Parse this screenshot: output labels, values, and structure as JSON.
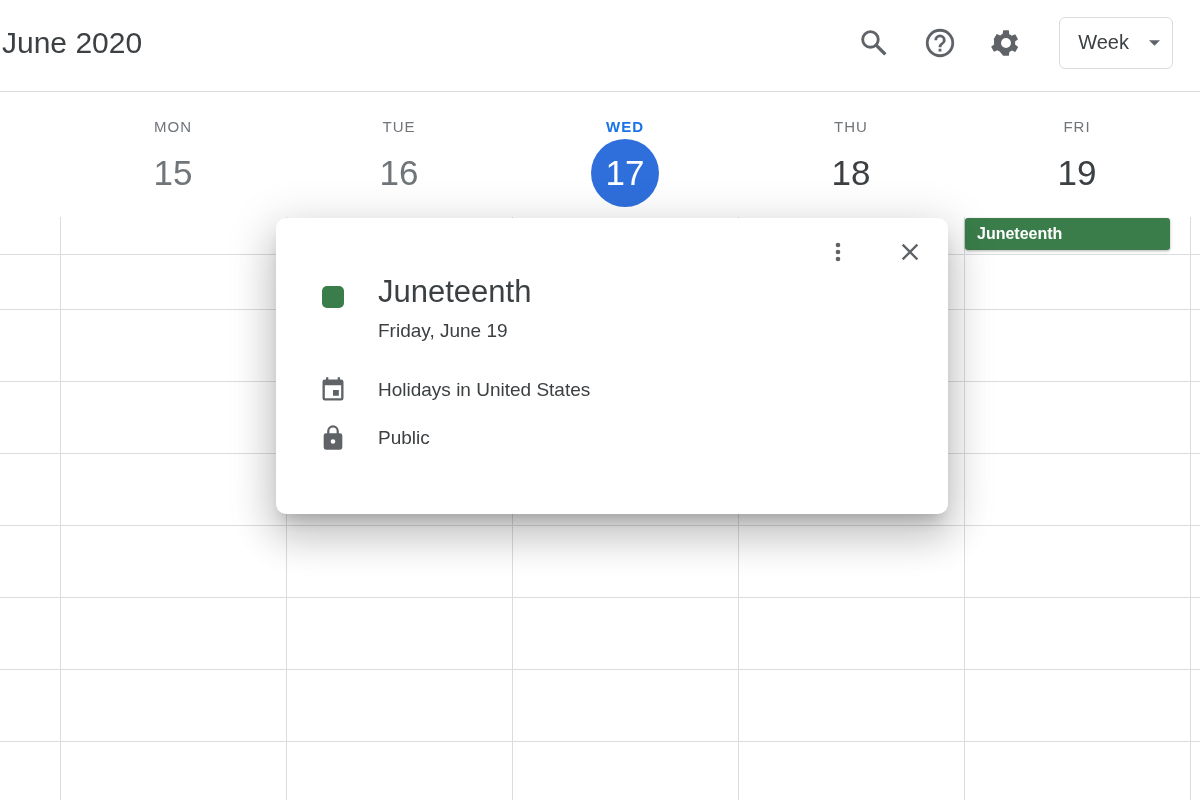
{
  "header": {
    "title": "June 2020",
    "view_select": {
      "value": "Week"
    }
  },
  "days": [
    {
      "weekday": "MON",
      "date": "15",
      "today": false,
      "past": true
    },
    {
      "weekday": "TUE",
      "date": "16",
      "today": false,
      "past": true
    },
    {
      "weekday": "WED",
      "date": "17",
      "today": true,
      "past": false
    },
    {
      "weekday": "THU",
      "date": "18",
      "today": false,
      "past": false
    },
    {
      "weekday": "FRI",
      "date": "19",
      "today": false,
      "past": false,
      "events": [
        {
          "title": "Juneteenth",
          "color": "#3a7d4a"
        }
      ]
    }
  ],
  "event_popup": {
    "title": "Juneteenth",
    "color": "#3a7d4a",
    "date": "Friday, June 19",
    "details": [
      {
        "kind": "calendar",
        "text": "Holidays in United States"
      },
      {
        "kind": "visibility",
        "text": "Public"
      }
    ]
  }
}
